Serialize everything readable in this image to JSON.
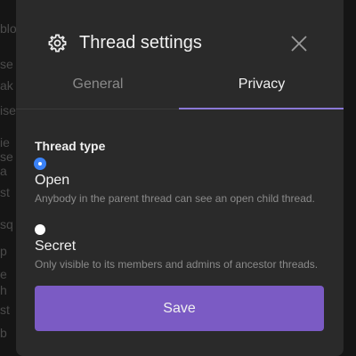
{
  "background": {
    "lines": [
      "blo",
      "se",
      "ak",
      "ise",
      "ie",
      "se",
      "a",
      "st",
      "sq",
      "p",
      "e",
      "h",
      "st",
      "b"
    ]
  },
  "dialog": {
    "title": "Thread settings",
    "title_icon": "gear-icon",
    "close_icon": "close-icon",
    "tabs": [
      {
        "label": "General",
        "active": false
      },
      {
        "label": "Privacy",
        "active": true
      }
    ],
    "section_label": "Thread type",
    "options": [
      {
        "title": "Open",
        "description": "Anybody in the parent thread can see an open child thread.",
        "selected": true
      },
      {
        "title": "Secret",
        "description": "Only visible to its members and admins of ancestor threads.",
        "selected": false
      }
    ],
    "save_label": "Save"
  },
  "colors": {
    "accent": "#7b5bc4",
    "tab_underline": "#8a78d6",
    "radio_selected": "#3b82f6",
    "modal_bg": "#2a2a2a"
  }
}
